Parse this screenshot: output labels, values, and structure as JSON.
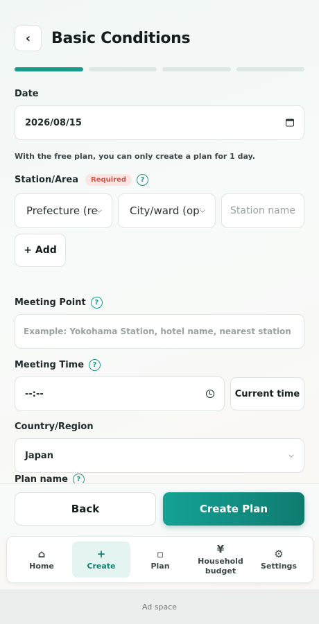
{
  "header": {
    "back_glyph": "‹",
    "title": "Basic Conditions"
  },
  "progress": {
    "total_steps": 4,
    "current_step": 1
  },
  "date": {
    "label": "Date",
    "value": "2026/08/15",
    "note": "With the free plan, you can only create a plan for 1 day."
  },
  "station": {
    "label": "Station/Area",
    "required_badge": "Required",
    "prefecture_value": "Prefecture (required)",
    "city_value": "City/ward (optional)",
    "station_placeholder": "Station name",
    "add_label": "+ Add"
  },
  "meeting_point": {
    "label": "Meeting Point",
    "placeholder": "Example: Yokohama Station, hotel name, nearest station"
  },
  "meeting_time": {
    "label": "Meeting Time",
    "value": "--:--",
    "current_time_label": "Current time"
  },
  "country": {
    "label": "Country/Region",
    "value": "Japan"
  },
  "plan_name": {
    "label": "Plan name"
  },
  "help_glyph": "?",
  "actions": {
    "back_label": "Back",
    "create_label": "Create Plan"
  },
  "tabbar": {
    "items": [
      {
        "label": "Home",
        "icon": "⌂"
      },
      {
        "label": "Create",
        "icon": "+"
      },
      {
        "label": "Plan",
        "icon": "▫"
      },
      {
        "label": "Household budget",
        "icon": "¥"
      },
      {
        "label": "Settings",
        "icon": "⚙"
      }
    ],
    "active_index": 1
  },
  "ad": {
    "label": "Ad space"
  },
  "colors": {
    "accent": "#1a9a8b",
    "primary_button": "#14a295",
    "required_badge_bg": "#fbe4e1",
    "required_badge_text": "#d2584a"
  }
}
